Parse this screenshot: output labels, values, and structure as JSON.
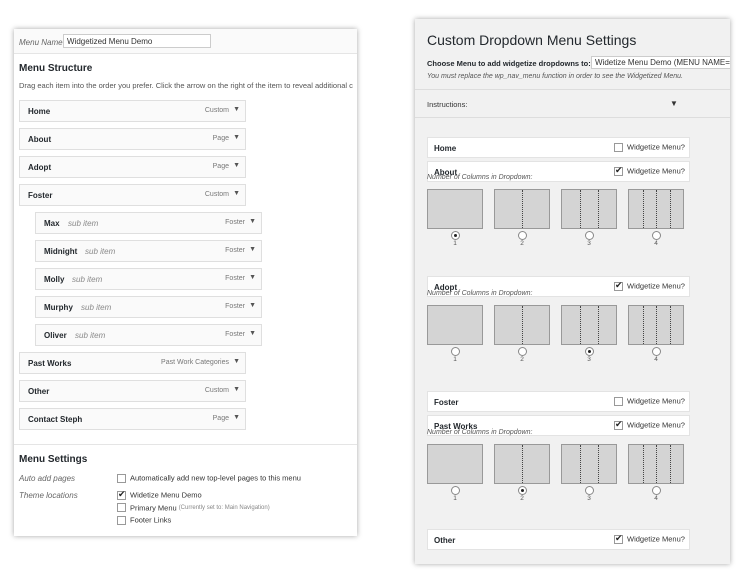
{
  "menu_editor": {
    "menu_name_label": "Menu Name",
    "menu_name_value": "Widgetized Menu Demo",
    "structure_title": "Menu Structure",
    "structure_desc": "Drag each item into the order you prefer. Click the arrow on the right of the item to reveal additional c",
    "items": [
      {
        "name": "Home",
        "type": "Custom",
        "sub": ""
      },
      {
        "name": "About",
        "type": "Page",
        "sub": ""
      },
      {
        "name": "Adopt",
        "type": "Page",
        "sub": ""
      },
      {
        "name": "Foster",
        "type": "Custom",
        "sub": ""
      },
      {
        "name": "Max",
        "type": "Foster",
        "sub": "sub item"
      },
      {
        "name": "Midnight",
        "type": "Foster",
        "sub": "sub item"
      },
      {
        "name": "Molly",
        "type": "Foster",
        "sub": "sub item"
      },
      {
        "name": "Murphy",
        "type": "Foster",
        "sub": "sub item"
      },
      {
        "name": "Oliver",
        "type": "Foster",
        "sub": "sub item"
      },
      {
        "name": "Past Works",
        "type": "Past Work Categories",
        "sub": ""
      },
      {
        "name": "Other",
        "type": "Custom",
        "sub": ""
      },
      {
        "name": "Contact Steph",
        "type": "Page",
        "sub": ""
      }
    ],
    "settings_title": "Menu Settings",
    "auto_add_label": "Auto add pages",
    "auto_add_text": "Automatically add new top-level pages to this menu",
    "auto_add_checked": false,
    "theme_locations_label": "Theme locations",
    "locations": [
      {
        "label": "Widetize Menu Demo",
        "note": "",
        "checked": true
      },
      {
        "label": "Primary Menu",
        "note": "(Currently set to: Main Navigation)",
        "checked": false
      },
      {
        "label": "Footer Links",
        "note": "",
        "checked": false
      }
    ]
  },
  "dropdown_settings": {
    "title": "Custom Dropdown Menu Settings",
    "choose_label": "Choose Menu to add widgetize dropdowns to:",
    "choose_value": "Widetize Menu Demo (MENU NAME=",
    "must_note": "You must replace the wp_nav_menu function in order to see the Widgetized Menu.",
    "instructions_label": "Instructions:",
    "instructions_arrow": "▼",
    "widgetize_label": "Widgetize Menu?",
    "columns_label": "Number of Columns in Dropdown:",
    "column_options": [
      "1",
      "2",
      "3",
      "4"
    ],
    "items": [
      {
        "name": "Home",
        "widgetize": false,
        "selected_columns": null
      },
      {
        "name": "About",
        "widgetize": true,
        "selected_columns": 1
      },
      {
        "name": "Adopt",
        "widgetize": true,
        "selected_columns": 3
      },
      {
        "name": "Foster",
        "widgetize": false,
        "selected_columns": null
      },
      {
        "name": "Past Works",
        "widgetize": true,
        "selected_columns": 2
      },
      {
        "name": "Other",
        "widgetize": true,
        "selected_columns": null
      }
    ]
  },
  "icons": {
    "dropdown_arrow": "chevron-down-icon",
    "checkbox": "checkbox-icon",
    "radio": "radio-icon"
  }
}
